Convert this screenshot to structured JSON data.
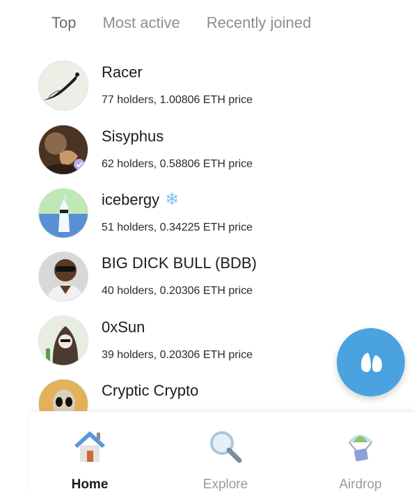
{
  "tabs": [
    {
      "label": "Top",
      "active": true
    },
    {
      "label": "Most active",
      "active": false
    },
    {
      "label": "Recently joined",
      "active": false
    }
  ],
  "rows": [
    {
      "name": "Racer",
      "subtitle": "77 holders, 1.00806 ETH price",
      "avatar": "racer-avatar"
    },
    {
      "name": "Sisyphus",
      "subtitle": "62 holders, 0.58806 ETH price",
      "avatar": "sisyphus-avatar",
      "verified": true
    },
    {
      "name": "icebergy",
      "subtitle": "51 holders, 0.34225 ETH price",
      "avatar": "icebergy-avatar",
      "badge": "snowflake-icon"
    },
    {
      "name": "BIG DICK BULL (BDB)",
      "subtitle": "40 holders, 0.20306 ETH price",
      "avatar": "bdb-avatar"
    },
    {
      "name": "0xSun",
      "subtitle": "39 holders, 0.20306 ETH price",
      "avatar": "oxsun-avatar"
    },
    {
      "name": "Cryptic Crypto",
      "subtitle": "",
      "avatar": "cryptic-crypto-avatar"
    }
  ],
  "fab": {
    "icon": "friendtech-logo-icon",
    "color": "#4aa3df"
  },
  "nav": {
    "items": [
      {
        "label": "Home",
        "icon": "house-icon",
        "active": true
      },
      {
        "label": "Explore",
        "icon": "magnifier-icon",
        "active": false
      },
      {
        "label": "Airdrop",
        "icon": "parachute-box-icon",
        "active": false
      }
    ]
  }
}
